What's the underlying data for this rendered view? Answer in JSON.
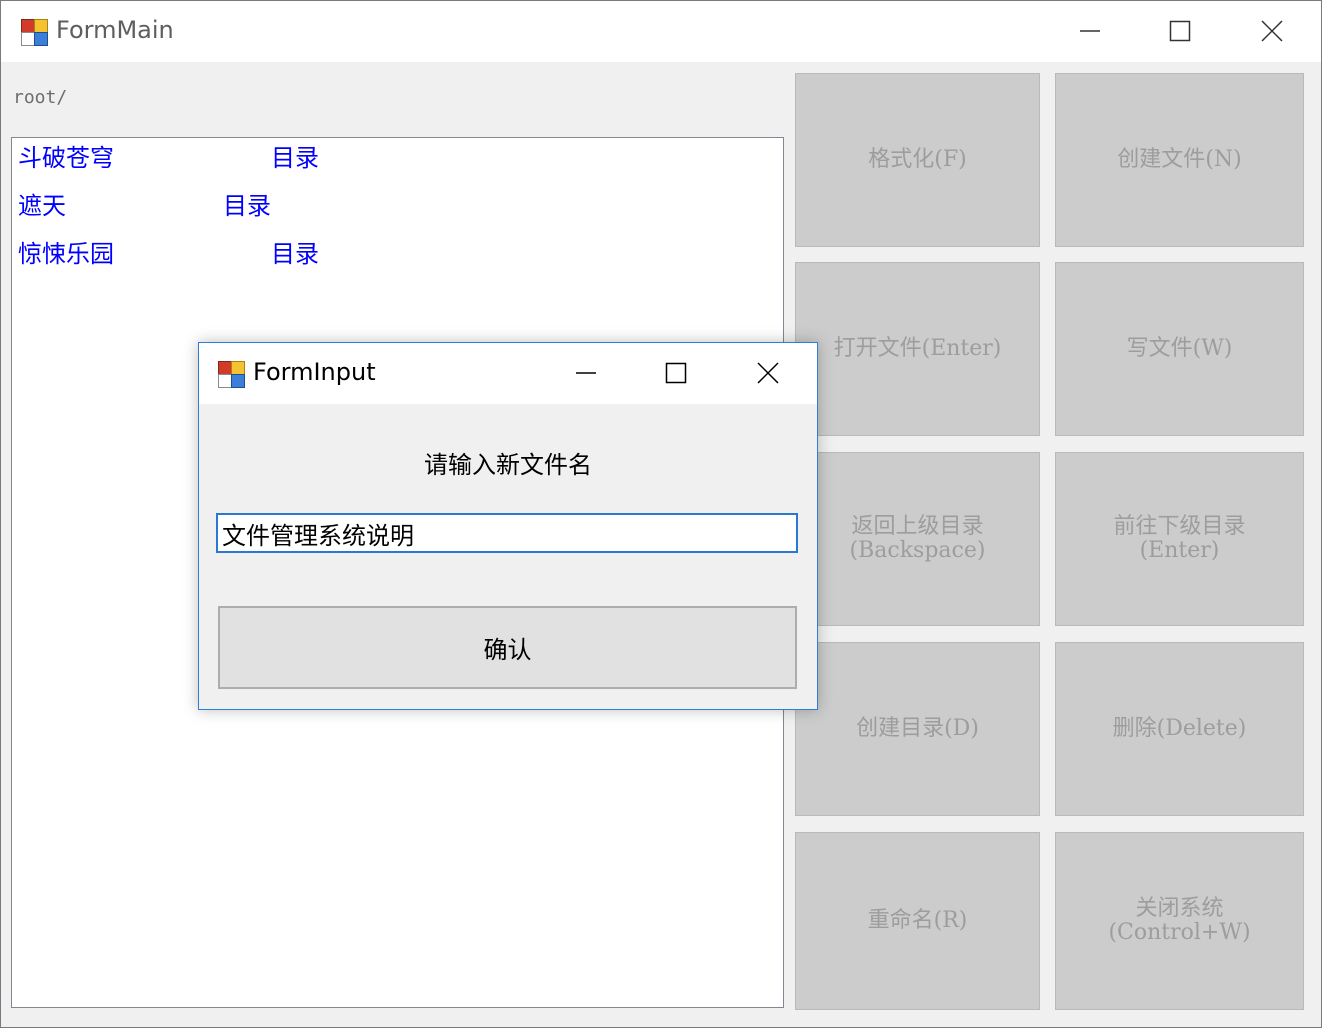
{
  "main_window": {
    "title": "FormMain",
    "path": "root/"
  },
  "file_list": [
    {
      "name": "斗破苍穹",
      "type": "目录"
    },
    {
      "name": "遮天",
      "type": "目录"
    },
    {
      "name": "惊悚乐园",
      "type": "目录"
    }
  ],
  "actions": [
    {
      "label": "格式化(F)"
    },
    {
      "label": "创建文件(N)"
    },
    {
      "label": "打开文件(Enter)"
    },
    {
      "label": "写文件(W)"
    },
    {
      "label": "返回上级目录\n(Backspace)"
    },
    {
      "label": "前往下级目录\n(Enter)"
    },
    {
      "label": "创建目录(D)"
    },
    {
      "label": "删除(Delete)"
    },
    {
      "label": "重命名(R)"
    },
    {
      "label": "关闭系统\n(Control+W)"
    }
  ],
  "dialog": {
    "title": "FormInput",
    "prompt": "请输入新文件名",
    "input_value": "文件管理系统说明",
    "confirm_label": "确认"
  },
  "icons": {
    "app": "app-icon",
    "minimize": "minimize-icon",
    "maximize": "maximize-icon",
    "close": "close-icon"
  },
  "colors": {
    "list_text": "#0000ff",
    "disabled_button": "#cccccc",
    "disabled_text": "#9d9d9d",
    "dialog_border": "#2b7fd6"
  }
}
